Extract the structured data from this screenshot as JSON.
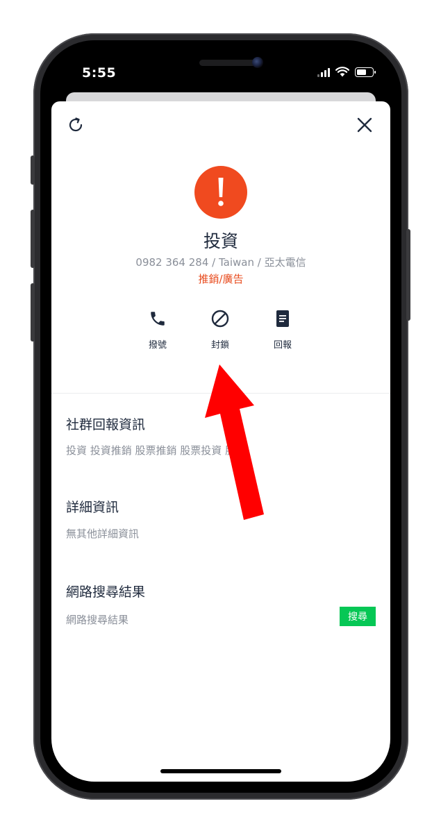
{
  "status_bar": {
    "time": "5:55"
  },
  "contact": {
    "name": "投資",
    "info": "0982 364 284 / Taiwan / 亞太電信",
    "category": "推銷/廣告"
  },
  "actions": {
    "call_label": "撥號",
    "block_label": "封鎖",
    "report_label": "回報"
  },
  "sections": {
    "community": {
      "title": "社群回報資訊",
      "body": "投資 投資推銷 股票推銷 股票投資 股票"
    },
    "details": {
      "title": "詳細資訊",
      "body": "無其他詳細資訊"
    },
    "web": {
      "title": "網路搜尋結果",
      "body": "網路搜尋結果",
      "search_label": "搜尋"
    }
  },
  "icons": {
    "refresh": "refresh-icon",
    "close": "close-icon",
    "alert": "exclamation-icon",
    "call": "phone-icon",
    "block": "block-icon",
    "report": "document-icon"
  },
  "colors": {
    "alert": "#f04a1f",
    "category": "#e84a1c",
    "search_button": "#06c755",
    "arrow": "#ff0000"
  }
}
